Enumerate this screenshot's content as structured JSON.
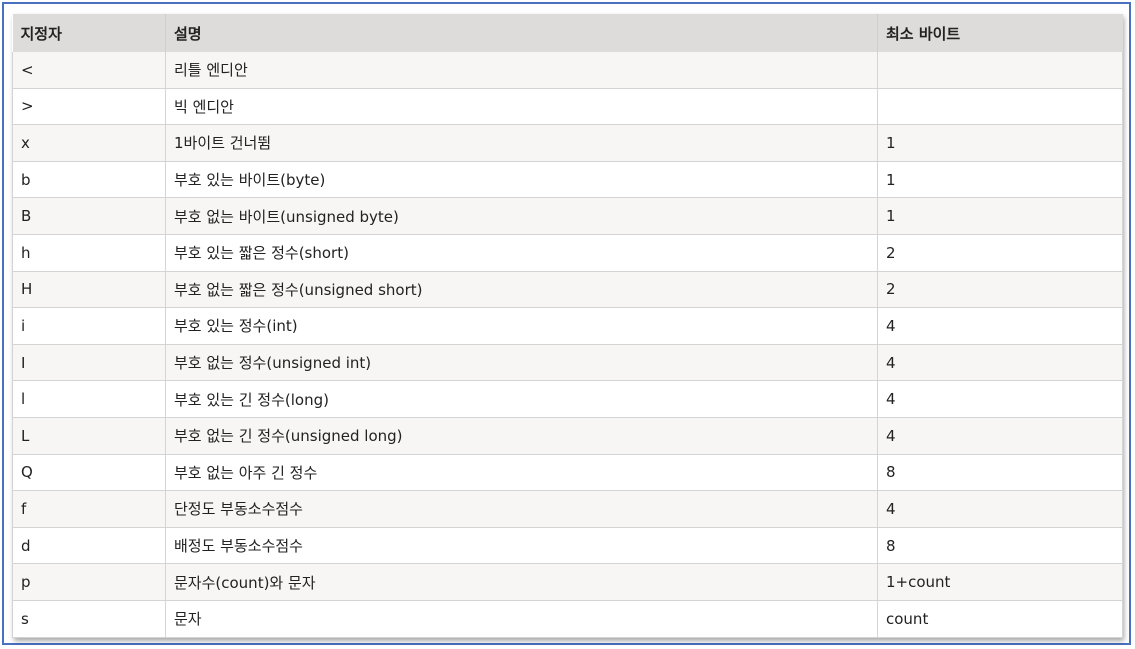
{
  "table": {
    "headers": [
      "지정자",
      "설명",
      "최소 바이트"
    ],
    "rows": [
      {
        "spec": "<",
        "desc": "리틀 엔디안",
        "bytes": ""
      },
      {
        "spec": ">",
        "desc": "빅 엔디안",
        "bytes": ""
      },
      {
        "spec": "x",
        "desc": "1바이트 건너뜀",
        "bytes": "1"
      },
      {
        "spec": "b",
        "desc": "부호 있는 바이트(byte)",
        "bytes": "1"
      },
      {
        "spec": "B",
        "desc": "부호 없는 바이트(unsigned byte)",
        "bytes": "1"
      },
      {
        "spec": "h",
        "desc": "부호 있는 짧은 정수(short)",
        "bytes": "2"
      },
      {
        "spec": "H",
        "desc": "부호 없는 짧은 정수(unsigned short)",
        "bytes": "2"
      },
      {
        "spec": "i",
        "desc": "부호 있는 정수(int)",
        "bytes": "4"
      },
      {
        "spec": "I",
        "desc": "부호 없는 정수(unsigned int)",
        "bytes": "4"
      },
      {
        "spec": "l",
        "desc": "부호 있는 긴 정수(long)",
        "bytes": "4"
      },
      {
        "spec": "L",
        "desc": "부호 없는 긴 정수(unsigned long)",
        "bytes": "4"
      },
      {
        "spec": "Q",
        "desc": "부호 없는 아주 긴 정수",
        "bytes": "8"
      },
      {
        "spec": "f",
        "desc": "단정도 부동소수점수",
        "bytes": "4"
      },
      {
        "spec": "d",
        "desc": "배정도 부동소수점수",
        "bytes": "8"
      },
      {
        "spec": "p",
        "desc": "문자수(count)와 문자",
        "bytes": "1+count"
      },
      {
        "spec": "s",
        "desc": "문자",
        "bytes": "count"
      }
    ]
  },
  "colors": {
    "frame_border": "#4a70c0",
    "header_bg": "#dedcdb",
    "row_alt_bg": "#f7f6f5"
  }
}
